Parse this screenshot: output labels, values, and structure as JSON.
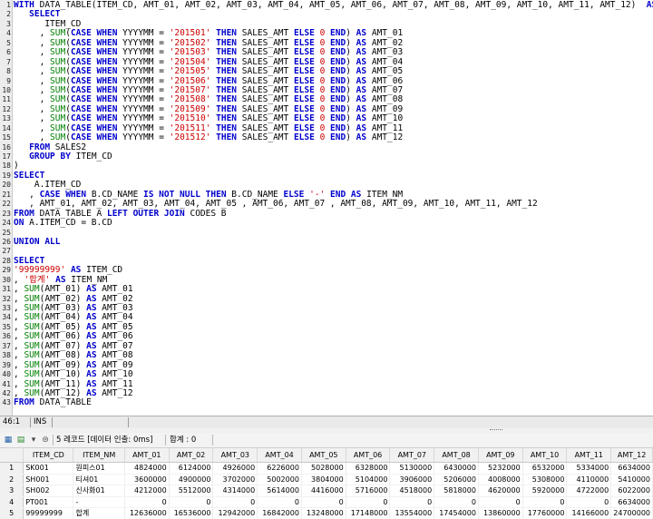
{
  "editor": {
    "lines": [
      [
        {
          "t": "WITH ",
          "c": "k"
        },
        {
          "t": "DATA_TABLE(ITEM_CD, AMT_01, AMT_02, AMT_03, AMT_04, AMT_05, AMT_06, AMT_07, AMT_08, AMT_09, AMT_10, AMT_11, AMT_12)  "
        },
        {
          "t": "AS",
          "c": "k"
        },
        {
          "t": "("
        }
      ],
      [
        {
          "t": "   "
        },
        {
          "t": "SELECT",
          "c": "k"
        }
      ],
      [
        {
          "t": "      ITEM_CD"
        }
      ],
      [
        {
          "t": "     , "
        },
        {
          "t": "SUM",
          "c": "f"
        },
        {
          "t": "("
        },
        {
          "t": "CASE WHEN",
          "c": "k"
        },
        {
          "t": " YYYYMM = "
        },
        {
          "t": "'201501'",
          "c": "s"
        },
        {
          "t": " "
        },
        {
          "t": "THEN",
          "c": "k"
        },
        {
          "t": " SALES_AMT "
        },
        {
          "t": "ELSE",
          "c": "k"
        },
        {
          "t": " "
        },
        {
          "t": "0",
          "c": "n"
        },
        {
          "t": " "
        },
        {
          "t": "END",
          "c": "k"
        },
        {
          "t": ") "
        },
        {
          "t": "AS",
          "c": "k"
        },
        {
          "t": " AMT_01"
        }
      ],
      [
        {
          "t": "     , "
        },
        {
          "t": "SUM",
          "c": "f"
        },
        {
          "t": "("
        },
        {
          "t": "CASE WHEN",
          "c": "k"
        },
        {
          "t": " YYYYMM = "
        },
        {
          "t": "'201502'",
          "c": "s"
        },
        {
          "t": " "
        },
        {
          "t": "THEN",
          "c": "k"
        },
        {
          "t": " SALES_AMT "
        },
        {
          "t": "ELSE",
          "c": "k"
        },
        {
          "t": " "
        },
        {
          "t": "0",
          "c": "n"
        },
        {
          "t": " "
        },
        {
          "t": "END",
          "c": "k"
        },
        {
          "t": ") "
        },
        {
          "t": "AS",
          "c": "k"
        },
        {
          "t": " AMT_02"
        }
      ],
      [
        {
          "t": "     , "
        },
        {
          "t": "SUM",
          "c": "f"
        },
        {
          "t": "("
        },
        {
          "t": "CASE WHEN",
          "c": "k"
        },
        {
          "t": " YYYYMM = "
        },
        {
          "t": "'201503'",
          "c": "s"
        },
        {
          "t": " "
        },
        {
          "t": "THEN",
          "c": "k"
        },
        {
          "t": " SALES_AMT "
        },
        {
          "t": "ELSE",
          "c": "k"
        },
        {
          "t": " "
        },
        {
          "t": "0",
          "c": "n"
        },
        {
          "t": " "
        },
        {
          "t": "END",
          "c": "k"
        },
        {
          "t": ") "
        },
        {
          "t": "AS",
          "c": "k"
        },
        {
          "t": " AMT_03"
        }
      ],
      [
        {
          "t": "     , "
        },
        {
          "t": "SUM",
          "c": "f"
        },
        {
          "t": "("
        },
        {
          "t": "CASE WHEN",
          "c": "k"
        },
        {
          "t": " YYYYMM = "
        },
        {
          "t": "'201504'",
          "c": "s"
        },
        {
          "t": " "
        },
        {
          "t": "THEN",
          "c": "k"
        },
        {
          "t": " SALES_AMT "
        },
        {
          "t": "ELSE",
          "c": "k"
        },
        {
          "t": " "
        },
        {
          "t": "0",
          "c": "n"
        },
        {
          "t": " "
        },
        {
          "t": "END",
          "c": "k"
        },
        {
          "t": ") "
        },
        {
          "t": "AS",
          "c": "k"
        },
        {
          "t": " AMT_04"
        }
      ],
      [
        {
          "t": "     , "
        },
        {
          "t": "SUM",
          "c": "f"
        },
        {
          "t": "("
        },
        {
          "t": "CASE WHEN",
          "c": "k"
        },
        {
          "t": " YYYYMM = "
        },
        {
          "t": "'201505'",
          "c": "s"
        },
        {
          "t": " "
        },
        {
          "t": "THEN",
          "c": "k"
        },
        {
          "t": " SALES_AMT "
        },
        {
          "t": "ELSE",
          "c": "k"
        },
        {
          "t": " "
        },
        {
          "t": "0",
          "c": "n"
        },
        {
          "t": " "
        },
        {
          "t": "END",
          "c": "k"
        },
        {
          "t": ") "
        },
        {
          "t": "AS",
          "c": "k"
        },
        {
          "t": " AMT_05"
        }
      ],
      [
        {
          "t": "     , "
        },
        {
          "t": "SUM",
          "c": "f"
        },
        {
          "t": "("
        },
        {
          "t": "CASE WHEN",
          "c": "k"
        },
        {
          "t": " YYYYMM = "
        },
        {
          "t": "'201506'",
          "c": "s"
        },
        {
          "t": " "
        },
        {
          "t": "THEN",
          "c": "k"
        },
        {
          "t": " SALES_AMT "
        },
        {
          "t": "ELSE",
          "c": "k"
        },
        {
          "t": " "
        },
        {
          "t": "0",
          "c": "n"
        },
        {
          "t": " "
        },
        {
          "t": "END",
          "c": "k"
        },
        {
          "t": ") "
        },
        {
          "t": "AS",
          "c": "k"
        },
        {
          "t": " AMT_06"
        }
      ],
      [
        {
          "t": "     , "
        },
        {
          "t": "SUM",
          "c": "f"
        },
        {
          "t": "("
        },
        {
          "t": "CASE WHEN",
          "c": "k"
        },
        {
          "t": " YYYYMM = "
        },
        {
          "t": "'201507'",
          "c": "s"
        },
        {
          "t": " "
        },
        {
          "t": "THEN",
          "c": "k"
        },
        {
          "t": " SALES_AMT "
        },
        {
          "t": "ELSE",
          "c": "k"
        },
        {
          "t": " "
        },
        {
          "t": "0",
          "c": "n"
        },
        {
          "t": " "
        },
        {
          "t": "END",
          "c": "k"
        },
        {
          "t": ") "
        },
        {
          "t": "AS",
          "c": "k"
        },
        {
          "t": " AMT_07"
        }
      ],
      [
        {
          "t": "     , "
        },
        {
          "t": "SUM",
          "c": "f"
        },
        {
          "t": "("
        },
        {
          "t": "CASE WHEN",
          "c": "k"
        },
        {
          "t": " YYYYMM = "
        },
        {
          "t": "'201508'",
          "c": "s"
        },
        {
          "t": " "
        },
        {
          "t": "THEN",
          "c": "k"
        },
        {
          "t": " SALES_AMT "
        },
        {
          "t": "ELSE",
          "c": "k"
        },
        {
          "t": " "
        },
        {
          "t": "0",
          "c": "n"
        },
        {
          "t": " "
        },
        {
          "t": "END",
          "c": "k"
        },
        {
          "t": ") "
        },
        {
          "t": "AS",
          "c": "k"
        },
        {
          "t": " AMT_08"
        }
      ],
      [
        {
          "t": "     , "
        },
        {
          "t": "SUM",
          "c": "f"
        },
        {
          "t": "("
        },
        {
          "t": "CASE WHEN",
          "c": "k"
        },
        {
          "t": " YYYYMM = "
        },
        {
          "t": "'201509'",
          "c": "s"
        },
        {
          "t": " "
        },
        {
          "t": "THEN",
          "c": "k"
        },
        {
          "t": " SALES_AMT "
        },
        {
          "t": "ELSE",
          "c": "k"
        },
        {
          "t": " "
        },
        {
          "t": "0",
          "c": "n"
        },
        {
          "t": " "
        },
        {
          "t": "END",
          "c": "k"
        },
        {
          "t": ") "
        },
        {
          "t": "AS",
          "c": "k"
        },
        {
          "t": " AMT_09"
        }
      ],
      [
        {
          "t": "     , "
        },
        {
          "t": "SUM",
          "c": "f"
        },
        {
          "t": "("
        },
        {
          "t": "CASE WHEN",
          "c": "k"
        },
        {
          "t": " YYYYMM = "
        },
        {
          "t": "'201510'",
          "c": "s"
        },
        {
          "t": " "
        },
        {
          "t": "THEN",
          "c": "k"
        },
        {
          "t": " SALES_AMT "
        },
        {
          "t": "ELSE",
          "c": "k"
        },
        {
          "t": " "
        },
        {
          "t": "0",
          "c": "n"
        },
        {
          "t": " "
        },
        {
          "t": "END",
          "c": "k"
        },
        {
          "t": ") "
        },
        {
          "t": "AS",
          "c": "k"
        },
        {
          "t": " AMT_10"
        }
      ],
      [
        {
          "t": "     , "
        },
        {
          "t": "SUM",
          "c": "f"
        },
        {
          "t": "("
        },
        {
          "t": "CASE WHEN",
          "c": "k"
        },
        {
          "t": " YYYYMM = "
        },
        {
          "t": "'201511'",
          "c": "s"
        },
        {
          "t": " "
        },
        {
          "t": "THEN",
          "c": "k"
        },
        {
          "t": " SALES_AMT "
        },
        {
          "t": "ELSE",
          "c": "k"
        },
        {
          "t": " "
        },
        {
          "t": "0",
          "c": "n"
        },
        {
          "t": " "
        },
        {
          "t": "END",
          "c": "k"
        },
        {
          "t": ") "
        },
        {
          "t": "AS",
          "c": "k"
        },
        {
          "t": " AMT_11"
        }
      ],
      [
        {
          "t": "     , "
        },
        {
          "t": "SUM",
          "c": "f"
        },
        {
          "t": "("
        },
        {
          "t": "CASE WHEN",
          "c": "k"
        },
        {
          "t": " YYYYMM = "
        },
        {
          "t": "'201512'",
          "c": "s"
        },
        {
          "t": " "
        },
        {
          "t": "THEN",
          "c": "k"
        },
        {
          "t": " SALES_AMT "
        },
        {
          "t": "ELSE",
          "c": "k"
        },
        {
          "t": " "
        },
        {
          "t": "0",
          "c": "n"
        },
        {
          "t": " "
        },
        {
          "t": "END",
          "c": "k"
        },
        {
          "t": ") "
        },
        {
          "t": "AS",
          "c": "k"
        },
        {
          "t": " AMT_12"
        }
      ],
      [
        {
          "t": "   "
        },
        {
          "t": "FROM",
          "c": "k"
        },
        {
          "t": " SALES2"
        }
      ],
      [
        {
          "t": "   "
        },
        {
          "t": "GROUP BY",
          "c": "k"
        },
        {
          "t": " ITEM_CD"
        }
      ],
      [
        {
          "t": ")"
        }
      ],
      [
        {
          "t": "SELECT",
          "c": "k"
        }
      ],
      [
        {
          "t": "    A.ITEM_CD"
        }
      ],
      [
        {
          "t": "   , "
        },
        {
          "t": "CASE WHEN",
          "c": "k"
        },
        {
          "t": " B.CD_NAME "
        },
        {
          "t": "IS NOT NULL",
          "c": "k"
        },
        {
          "t": " "
        },
        {
          "t": "THEN",
          "c": "k"
        },
        {
          "t": " B.CD_NAME "
        },
        {
          "t": "ELSE",
          "c": "k"
        },
        {
          "t": " "
        },
        {
          "t": "'-'",
          "c": "s"
        },
        {
          "t": " "
        },
        {
          "t": "END AS",
          "c": "k"
        },
        {
          "t": " ITEM_NM"
        }
      ],
      [
        {
          "t": "   , AMT_01, AMT_02, AMT_03, AMT_04, AMT_05 , AMT_06, AMT_07 , AMT_08, AMT_09, AMT_10, AMT_11, AMT_12"
        }
      ],
      [
        {
          "t": "FROM",
          "c": "k"
        },
        {
          "t": " DATA_TABLE A "
        },
        {
          "t": "LEFT OUTER JOIN",
          "c": "k"
        },
        {
          "t": " CODES B"
        }
      ],
      [
        {
          "t": "ON",
          "c": "k"
        },
        {
          "t": " A.ITEM_CD = B.CD"
        }
      ],
      [],
      [
        {
          "t": "UNION ALL",
          "c": "k"
        }
      ],
      [],
      [
        {
          "t": "SELECT",
          "c": "k"
        }
      ],
      [
        {
          "t": "'99999999'",
          "c": "s"
        },
        {
          "t": " "
        },
        {
          "t": "AS",
          "c": "k"
        },
        {
          "t": " ITEM_CD"
        }
      ],
      [
        {
          "t": ", "
        },
        {
          "t": "'합계'",
          "c": "s"
        },
        {
          "t": " "
        },
        {
          "t": "AS",
          "c": "k"
        },
        {
          "t": " ITEM_NM"
        }
      ],
      [
        {
          "t": ", "
        },
        {
          "t": "SUM",
          "c": "f"
        },
        {
          "t": "(AMT_01) "
        },
        {
          "t": "AS",
          "c": "k"
        },
        {
          "t": " AMT_01"
        }
      ],
      [
        {
          "t": ", "
        },
        {
          "t": "SUM",
          "c": "f"
        },
        {
          "t": "(AMT_02) "
        },
        {
          "t": "AS",
          "c": "k"
        },
        {
          "t": " AMT_02"
        }
      ],
      [
        {
          "t": ", "
        },
        {
          "t": "SUM",
          "c": "f"
        },
        {
          "t": "(AMT_03) "
        },
        {
          "t": "AS",
          "c": "k"
        },
        {
          "t": " AMT_03"
        }
      ],
      [
        {
          "t": ", "
        },
        {
          "t": "SUM",
          "c": "f"
        },
        {
          "t": "(AMT_04) "
        },
        {
          "t": "AS",
          "c": "k"
        },
        {
          "t": " AMT_04"
        }
      ],
      [
        {
          "t": ", "
        },
        {
          "t": "SUM",
          "c": "f"
        },
        {
          "t": "(AMT_05) "
        },
        {
          "t": "AS",
          "c": "k"
        },
        {
          "t": " AMT_05"
        }
      ],
      [
        {
          "t": ", "
        },
        {
          "t": "SUM",
          "c": "f"
        },
        {
          "t": "(AMT_06) "
        },
        {
          "t": "AS",
          "c": "k"
        },
        {
          "t": " AMT_06"
        }
      ],
      [
        {
          "t": ", "
        },
        {
          "t": "SUM",
          "c": "f"
        },
        {
          "t": "(AMT_07) "
        },
        {
          "t": "AS",
          "c": "k"
        },
        {
          "t": " AMT_07"
        }
      ],
      [
        {
          "t": ", "
        },
        {
          "t": "SUM",
          "c": "f"
        },
        {
          "t": "(AMT_08) "
        },
        {
          "t": "AS",
          "c": "k"
        },
        {
          "t": " AMT_08"
        }
      ],
      [
        {
          "t": ", "
        },
        {
          "t": "SUM",
          "c": "f"
        },
        {
          "t": "(AMT_09) "
        },
        {
          "t": "AS",
          "c": "k"
        },
        {
          "t": " AMT_09"
        }
      ],
      [
        {
          "t": ", "
        },
        {
          "t": "SUM",
          "c": "f"
        },
        {
          "t": "(AMT_10) "
        },
        {
          "t": "AS",
          "c": "k"
        },
        {
          "t": " AMT_10"
        }
      ],
      [
        {
          "t": ", "
        },
        {
          "t": "SUM",
          "c": "f"
        },
        {
          "t": "(AMT_11) "
        },
        {
          "t": "AS",
          "c": "k"
        },
        {
          "t": " AMT_11"
        }
      ],
      [
        {
          "t": ", "
        },
        {
          "t": "SUM",
          "c": "f"
        },
        {
          "t": "(AMT_12) "
        },
        {
          "t": "AS",
          "c": "k"
        },
        {
          "t": " AMT_12"
        }
      ],
      [
        {
          "t": "FROM",
          "c": "k"
        },
        {
          "t": " DATA_TABLE"
        }
      ]
    ]
  },
  "status": {
    "position": "46:1",
    "mode": "INS"
  },
  "results": {
    "record_summary": "5 레코드 [데이터 인출: 0ms]",
    "total_label": "합계 : 0",
    "columns": [
      "ITEM_CD",
      "ITEM_NM",
      "AMT_01",
      "AMT_02",
      "AMT_03",
      "AMT_04",
      "AMT_05",
      "AMT_06",
      "AMT_07",
      "AMT_08",
      "AMT_09",
      "AMT_10",
      "AMT_11",
      "AMT_12"
    ],
    "rows": [
      [
        "1",
        "SK001",
        "원피스01",
        "4824000",
        "6124000",
        "4926000",
        "6226000",
        "5028000",
        "6328000",
        "5130000",
        "6430000",
        "5232000",
        "6532000",
        "5334000",
        "6634000"
      ],
      [
        "2",
        "SH001",
        "티셔01",
        "3600000",
        "4900000",
        "3702000",
        "5002000",
        "3804000",
        "5104000",
        "3906000",
        "5206000",
        "4008000",
        "5308000",
        "4110000",
        "5410000"
      ],
      [
        "3",
        "SH002",
        "신사화01",
        "4212000",
        "5512000",
        "4314000",
        "5614000",
        "4416000",
        "5716000",
        "4518000",
        "5818000",
        "4620000",
        "5920000",
        "4722000",
        "6022000"
      ],
      [
        "4",
        "PT001",
        "-",
        "0",
        "0",
        "0",
        "0",
        "0",
        "0",
        "0",
        "0",
        "0",
        "0",
        "0",
        "6634000"
      ],
      [
        "5",
        "99999999",
        "합계",
        "12636000",
        "16536000",
        "12942000",
        "16842000",
        "13248000",
        "17148000",
        "13554000",
        "17454000",
        "13860000",
        "17760000",
        "14166000",
        "24700000"
      ]
    ]
  },
  "colors": {
    "keyword": "#0000cc",
    "function": "#008000",
    "string": "#cc0000"
  }
}
